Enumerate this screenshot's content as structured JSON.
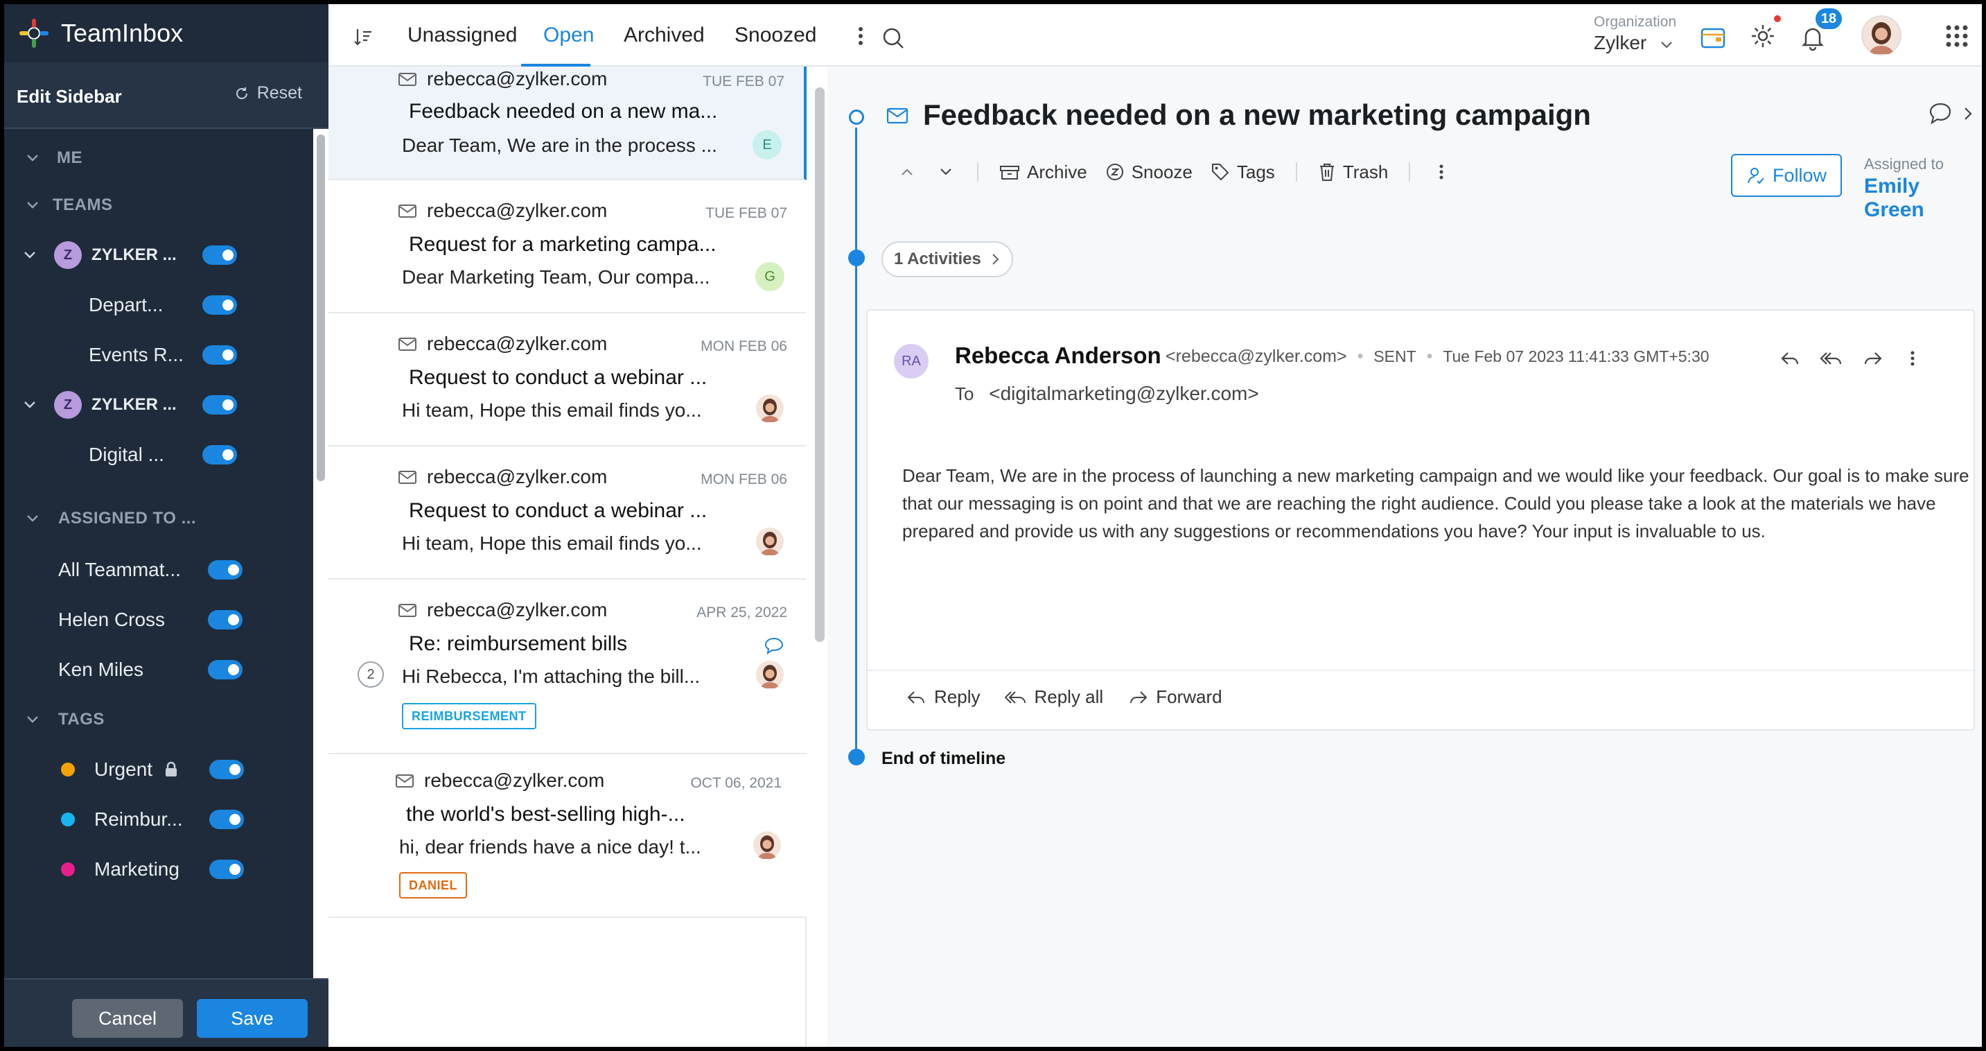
{
  "app": {
    "name": "TeamInbox"
  },
  "sidebar": {
    "edit_title": "Edit Sidebar",
    "reset_label": "Reset",
    "sections": {
      "me": "ME",
      "teams": "TEAMS",
      "assigned": "ASSIGNED TO ...",
      "tags": "TAGS"
    },
    "teams": [
      {
        "initial": "Z",
        "label": "ZYLKER ...",
        "enabled": true
      },
      {
        "label": "Depart...",
        "enabled": true
      },
      {
        "label": "Events R...",
        "enabled": true
      },
      {
        "initial": "Z",
        "label": "ZYLKER ...",
        "enabled": true
      },
      {
        "label": "Digital ...",
        "enabled": true
      }
    ],
    "assigned": [
      {
        "label": "All Teammat...",
        "enabled": true
      },
      {
        "label": "Helen Cross",
        "enabled": true
      },
      {
        "label": "Ken Miles",
        "enabled": true
      }
    ],
    "tags": [
      {
        "label": "Urgent",
        "color": "#f5a100",
        "locked": true,
        "enabled": true
      },
      {
        "label": "Reimbur...",
        "color": "#18b4f0",
        "enabled": true
      },
      {
        "label": "Marketing",
        "color": "#e91e8c",
        "enabled": true
      }
    ],
    "cancel_label": "Cancel",
    "save_label": "Save"
  },
  "topbar": {
    "tabs": [
      "Unassigned",
      "Open",
      "Archived",
      "Snoozed"
    ],
    "active_tab": "Open",
    "org_label": "Organization",
    "org_value": "Zylker",
    "notification_count": "18"
  },
  "list": [
    {
      "from": "rebecca@zylker.com",
      "date": "TUE FEB 07",
      "subject": "Feedback needed on a new ma...",
      "preview": "Dear Team, We are in the process ...",
      "avatar": "E",
      "avatar_color": "#c8f0ec",
      "selected": true
    },
    {
      "from": "rebecca@zylker.com",
      "date": "TUE FEB 07",
      "subject": "Request for a marketing campa...",
      "preview": "Dear Marketing Team, Our compa...",
      "avatar": "G",
      "avatar_color": "#d6f0c0"
    },
    {
      "from": "rebecca@zylker.com",
      "date": "MON FEB 06",
      "subject": "Request to conduct a webinar ...",
      "preview": "Hi team, Hope this email finds yo..."
    },
    {
      "from": "rebecca@zylker.com",
      "date": "MON FEB 06",
      "subject": "Request to conduct a webinar ...",
      "preview": "Hi team, Hope this email finds yo..."
    },
    {
      "from": "rebecca@zylker.com",
      "date": "APR 25, 2022",
      "subject": "Re: reimbursement bills",
      "preview": "Hi Rebecca, I'm attaching the bill...",
      "thread_count": "2",
      "tag": "REIMBURSEMENT",
      "tag_color": "#18a4e0"
    },
    {
      "from": "rebecca@zylker.com",
      "date": "OCT 06, 2021",
      "subject": "the world's best-selling high-...",
      "preview": "hi, dear friends have a nice day! t...",
      "tag": "DANIEL",
      "tag_color": "#e06a10"
    }
  ],
  "detail": {
    "subject": "Feedback needed on a new marketing campaign",
    "actions": {
      "archive": "Archive",
      "snooze": "Snooze",
      "tags": "Tags",
      "trash": "Trash"
    },
    "follow_label": "Follow",
    "assigned_label": "Assigned to",
    "assigned_value": "Emily Green",
    "activities_label": "1 Activities",
    "message": {
      "initials": "RA",
      "sender": "Rebecca Anderson",
      "sender_email": "<rebecca@zylker.com>",
      "status": "SENT",
      "timestamp": "Tue Feb 07 2023 11:41:33 GMT+5:30",
      "to_label": "To",
      "to_value": "<digitalmarketing@zylker.com>",
      "body": "Dear Team, We are in the process of launching a new marketing campaign and we would like your feedback. Our goal is to make sure that our messaging is on point and that we are reaching the right audience. Could you please take a look at the materials we have prepared and provide us with any suggestions or recommendations you have? Your input is invaluable to us."
    },
    "reply_label": "Reply",
    "reply_all_label": "Reply all",
    "forward_label": "Forward",
    "end_label": "End of timeline"
  }
}
